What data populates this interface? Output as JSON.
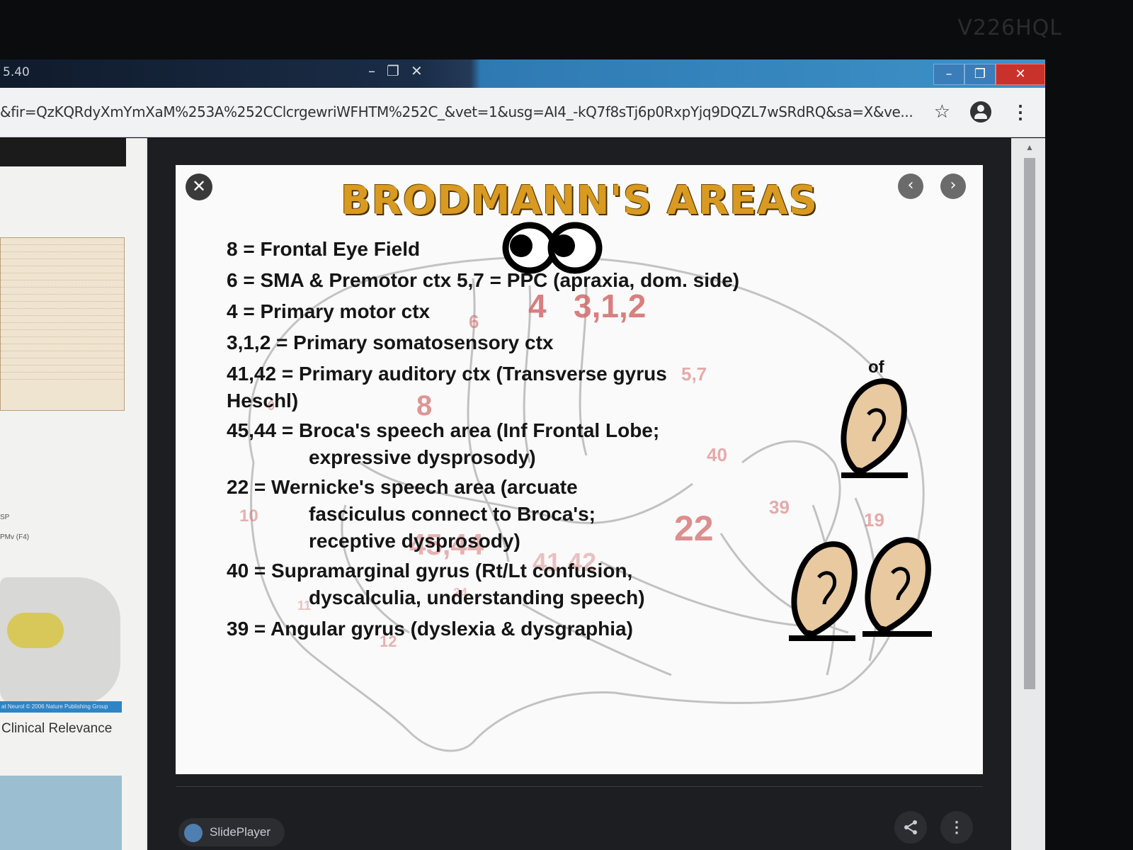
{
  "monitor": {
    "brand": "V226HQL"
  },
  "titlebar": {
    "title": "5.40",
    "inner_controls": {
      "minimize": "–",
      "restore": "❐",
      "close": "✕"
    },
    "window_controls": {
      "minimize": "–",
      "maximize": "❐",
      "close": "✕"
    }
  },
  "addressbar": {
    "url": "&fir=QzKQRdyXmYmXaM%253A%252CClcrgewriWFHTM%252C_&vet=1&usg=AI4_-kQ7f8sTj6p0RxpYjq9DQZL7wSRdRQ&sa=X&ve...",
    "star_icon": "☆",
    "menu_icon": "⋮"
  },
  "left_panel": {
    "label_sp": "SP",
    "label_pmv": "PMv (F4)",
    "caption": "at Neurol © 2006 Nature Publishing Group",
    "relevance": "Clinical Relevance"
  },
  "slide": {
    "title": "BRODMANN'S AREAS",
    "close_icon": "✕",
    "prev_icon": "‹",
    "next_icon": "›",
    "lines": [
      "8 = Frontal Eye Field",
      "6 = SMA & Premotor ctx   5,7 = PPC (apraxia, dom. side)",
      "4 = Primary motor ctx",
      "3,1,2 = Primary somatosensory ctx",
      "41,42 = Primary auditory ctx (Transverse gyrus",
      "Heschl)",
      "45,44 = Broca's speech area (Inf Frontal Lobe;",
      "expressive dysprosody)",
      "22 = Wernicke's speech area (arcuate",
      "fasciculus connect to Broca's;",
      "receptive dysprosody)",
      "40 = Supramarginal gyrus (Rt/Lt confusion,",
      "dyscalculia, understanding speech)",
      "39 = Angular gyrus (dyslexia & dysgraphia)"
    ],
    "of_label": "of",
    "brain_labels": {
      "a4": "4",
      "a312": "3,1,2",
      "a6": "6",
      "a8": "8",
      "a57": "5,7",
      "a40": "40",
      "a39": "39",
      "a19": "19",
      "a22": "22",
      "a10": "10",
      "a4544": "45,44",
      "a4142": "41,42",
      "a34": "34",
      "a12": "12",
      "a9": "9",
      "a11": "11"
    }
  },
  "viewer": {
    "brand": "SlidePlayer",
    "share_icon": "share",
    "more_icon": "⋮"
  },
  "colors": {
    "title_orange": "#d99a22",
    "watermark_red": "#d46a6a",
    "ear_skin": "#e8c9a0"
  }
}
